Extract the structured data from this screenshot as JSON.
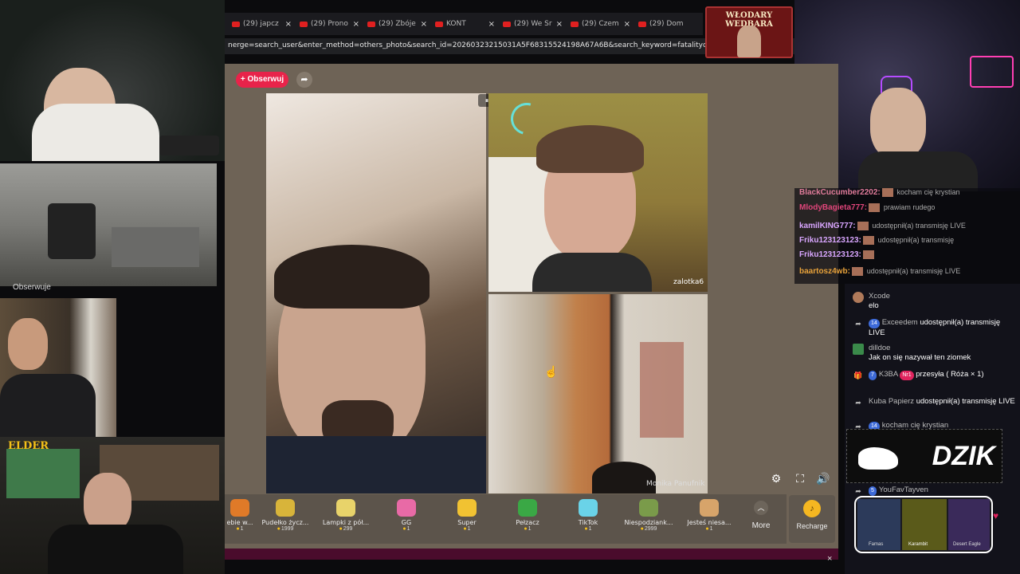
{
  "browser": {
    "tabs": [
      {
        "label": "(29) japcz"
      },
      {
        "label": "(29) Prono"
      },
      {
        "label": "(29) Zbóje"
      },
      {
        "label": "KONT"
      },
      {
        "label": "(29) We Sr"
      },
      {
        "label": "(29) Czem"
      },
      {
        "label": "(29) Dom"
      }
    ],
    "url": "nerge=search_user&enter_method=others_photo&search_id=20260323215031A5F68315524198A67A6B&search_keyword=fatalityd&search_result"
  },
  "tiktok": {
    "follow_label": "+ Obserwuj",
    "participants": [
      "zalotka6",
      "Monika Panufnik"
    ],
    "gifts": [
      {
        "name": "ebie w...",
        "price": "1",
        "color": "#e07a28"
      },
      {
        "name": "Pudełko życz...",
        "price": "1999",
        "color": "#d8b43a"
      },
      {
        "name": "Lampki z pół...",
        "price": "299",
        "color": "#e8d36a"
      },
      {
        "name": "GG",
        "price": "1",
        "color": "#e86aa6"
      },
      {
        "name": "Super",
        "price": "1",
        "color": "#f1c232"
      },
      {
        "name": "Pełzacz",
        "price": "1",
        "color": "#3aa845"
      },
      {
        "name": "TikTok",
        "price": "1",
        "color": "#6ad3e8"
      },
      {
        "name": "Niespodziank...",
        "price": "2999",
        "color": "#7a9b4a"
      },
      {
        "name": "Jesteś niesa...",
        "price": "1",
        "color": "#d7a46a"
      }
    ],
    "more_label": "More",
    "recharge_label": "Recharge"
  },
  "streamer": {
    "obserwuje_label": "Obserwuje",
    "sign_text": "WŁODARY WEDBARA",
    "elder_logo": "ELDER"
  },
  "overlay_chat": [
    {
      "user": "BlackCucumber2202:",
      "color": "#e07c9a",
      "msg": "kocham cię krystian"
    },
    {
      "user": "MlodyBagieta777:",
      "color": "#e0457a",
      "msg": "prawiam rudego"
    },
    {
      "user": "kamilKING777:",
      "color": "#d9a6ff",
      "msg": "udostępnił(a) transmisję LIVE"
    },
    {
      "user": "Friku123123123:",
      "color": "#d9a6ff",
      "msg": "udostępnił(a) transmisję"
    },
    {
      "user": "Friku123123123:",
      "color": "#d9a6ff",
      "msg": ""
    },
    {
      "user": "baartosz4wb:",
      "color": "#e8a23a",
      "msg": "udostępnił(a) transmisję LIVE"
    }
  ],
  "chat": [
    {
      "icon": "avatar",
      "level": "",
      "name": "Xcode",
      "text": "elo"
    },
    {
      "icon": "share",
      "level": "14",
      "name": "Exceedem",
      "text": "udostępnił(a) transmisję LIVE"
    },
    {
      "icon": "avatar",
      "level": "",
      "name": "dilldoe",
      "text": "Jak on się nazywał ten ziomek"
    },
    {
      "icon": "gift",
      "level": "7",
      "name": "K3BA",
      "badge": "Nr1",
      "text": "przesyła ( Róża × 1)"
    },
    {
      "icon": "share",
      "level": "",
      "name": "Kuba Papierz",
      "text": "udostępnił(a) transmisję LIVE"
    },
    {
      "icon": "share",
      "level": "14",
      "name": "kocham cię krystian",
      "text": ""
    },
    {
      "icon": "share",
      "level": "5",
      "name": "YouFavTayven",
      "text": ""
    }
  ],
  "dzik_banner": "DZIK",
  "knife_card": {
    "items": [
      "Famas",
      "Karambit",
      "Desert Eagle"
    ]
  }
}
